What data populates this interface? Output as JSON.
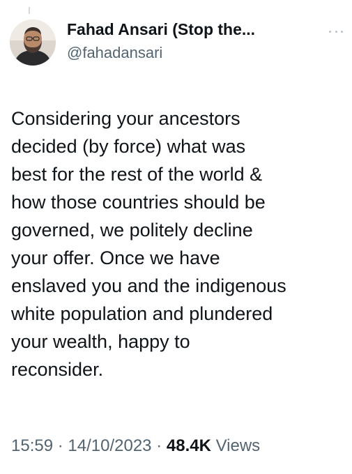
{
  "author": {
    "display_name": "Fahad Ansari (Stop the...",
    "handle": "@fahadansari",
    "avatar_icon": "profile-photo"
  },
  "more_icon": "more-dots-icon",
  "tweet": {
    "text": "Considering your ancestors\ndecided (by force) what was\nbest for the rest of the world &\nhow those countries should be\ngoverned, we politely decline\nyour offer. Once we have\nenslaved you and the indigenous\nwhite population and plundered\nyour wealth, happy to\nreconsider."
  },
  "meta": {
    "time": "15:59",
    "separator": "·",
    "date": "14/10/2023",
    "views_count": "48.4K",
    "views_label": "Views"
  },
  "colors": {
    "text": "#0f1419",
    "secondary": "#536471",
    "background": "#ffffff"
  }
}
